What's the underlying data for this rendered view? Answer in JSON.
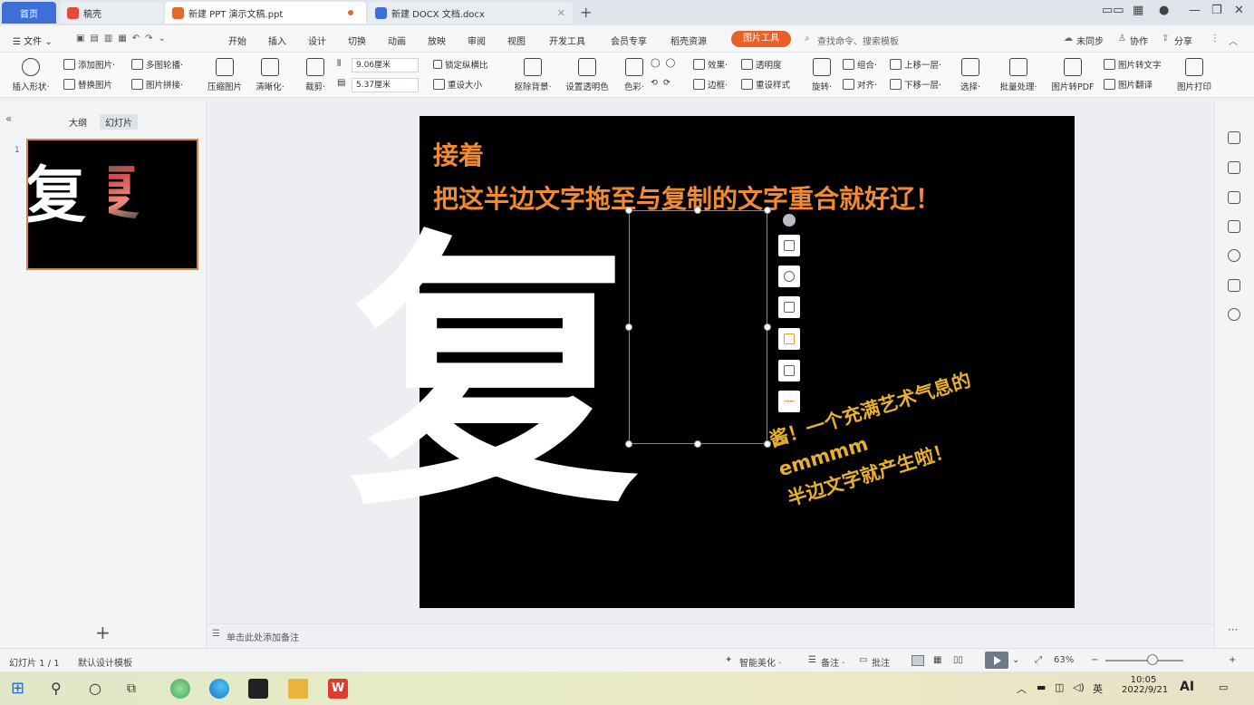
{
  "tabs": {
    "home": "首页",
    "draft": "稿壳",
    "ppt": "新建 PPT 演示文稿.ppt",
    "docx": "新建 DOCX 文档.docx"
  },
  "window": {
    "new_tab": "+",
    "minimize": "—",
    "restore": "❐",
    "close": "✕"
  },
  "menu": {
    "file": "☰ 文件 ⌄",
    "items": [
      "开始",
      "插入",
      "设计",
      "切换",
      "动画",
      "放映",
      "审阅",
      "视图",
      "开发工具",
      "会员专享",
      "稻壳资源"
    ],
    "picture_tools": "图片工具",
    "search": "查找命令、搜索模板",
    "sync": "未同步",
    "collab": "协作",
    "share": "分享"
  },
  "ribbon": {
    "insert_shape": "插入形状·",
    "add_picture": "添加图片·",
    "multi_crop": "多图轮播·",
    "replace_picture": "替换图片",
    "picture_collage": "图片拼接·",
    "compress": "压缩图片",
    "sharpen": "清晰化·",
    "crop": "裁剪·",
    "width": "9.06厘米",
    "height": "5.37厘米",
    "lock_ratio": "锁定纵横比",
    "reset_size": "重设大小",
    "remove_bg": "抠除背景·",
    "set_transparent": "设置透明色",
    "color": "色彩·",
    "effects": "效果·",
    "transparency": "透明度",
    "border": "边框·",
    "reset_style": "重设样式",
    "rotate": "旋转·",
    "group": "组合·",
    "align": "对齐·",
    "bring_forward": "上移一层·",
    "send_backward": "下移一层·",
    "select": "选择·",
    "batch": "批量处理·",
    "to_pdf": "图片转PDF",
    "to_text": "图片转文字",
    "translate": "图片翻译",
    "print": "图片打印"
  },
  "left_panel": {
    "outline": "大纲",
    "slides": "幻灯片",
    "slide_number": "1",
    "add": "+"
  },
  "slide": {
    "line1": "接着",
    "line2": "把这半边文字拖至与复制的文字重合就好辽！",
    "big_char": "复",
    "yellow_lines": [
      "酱！一个充满艺术气息的",
      "emmmm",
      "半边文字就产生啦！"
    ]
  },
  "notes_placeholder": "单击此处添加备注",
  "status": {
    "slide_count": "幻灯片 1 / 1",
    "theme": "默认设计模板",
    "smart_beautify": "智能美化 ·",
    "notes": "备注 ·",
    "comments": "批注",
    "zoom": "63%",
    "zoom_minus": "−",
    "zoom_plus": "+"
  },
  "taskbar": {
    "time": "10:05",
    "date": "2022/9/21",
    "ime": "英",
    "ai_label": "AI"
  },
  "colors": {
    "accent": "#e9612a",
    "title_text": "#f08a33",
    "yellow_text": "#e8b12c"
  }
}
